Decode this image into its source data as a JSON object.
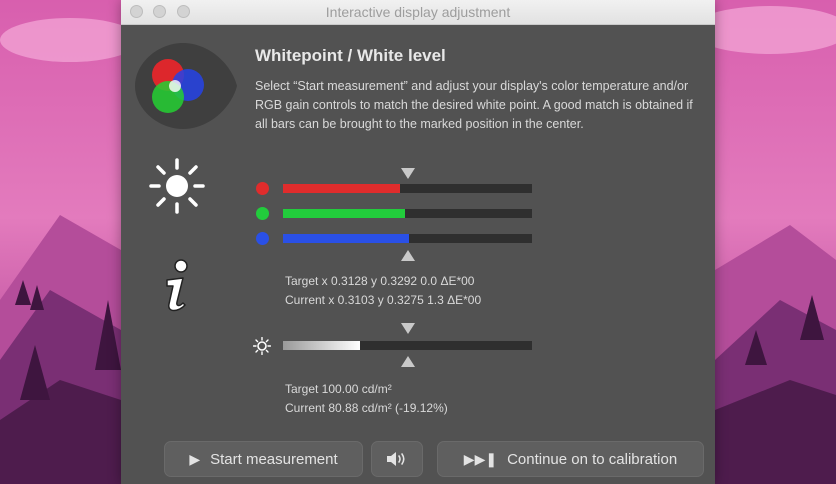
{
  "window": {
    "title": "Interactive display adjustment"
  },
  "section": {
    "heading": "Whitepoint / White level",
    "description": "Select “Start measurement” and adjust your display's color temperature and/or RGB gain controls to match the desired white point. A good match is obtained if all bars can be brought to the marked position in the center."
  },
  "rgb_bars": [
    {
      "channel": "red",
      "color": "#e02c2c",
      "level_fraction": 0.47
    },
    {
      "channel": "green",
      "color": "#22cc3c",
      "level_fraction": 0.49
    },
    {
      "channel": "blue",
      "color": "#2a50e6",
      "level_fraction": 0.505
    }
  ],
  "whitepoint_readout": {
    "target": "Target x 0.3128 y 0.3292 0.0 ΔE*00",
    "current": "Current x 0.3103 y 0.3275 1.3 ΔE*00"
  },
  "luminance_bar": {
    "level_fraction": 0.31
  },
  "luminance_readout": {
    "target": "Target 100.00 cd/m²",
    "current": "Current 80.88 cd/m² (-19.12%)"
  },
  "buttons": {
    "start_measurement": "Start measurement",
    "continue_calibration": "Continue on to calibration"
  },
  "icons": {
    "play": "play-icon",
    "speaker": "speaker-icon",
    "skip_forward": "skip-forward-icon",
    "rgb_logo": "rgb-circles-logo",
    "sun": "sun-icon",
    "info": "info-icon"
  }
}
